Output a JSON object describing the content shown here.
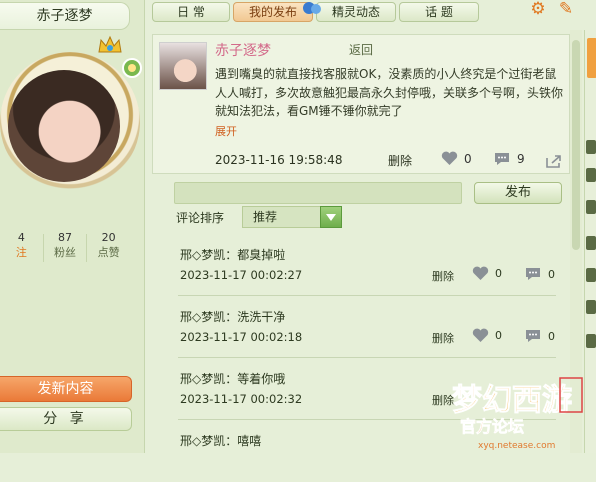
{
  "profile": {
    "username": "赤子逐梦",
    "stats": [
      {
        "num": "4",
        "label": "注"
      },
      {
        "num": "87",
        "label": "粉丝"
      },
      {
        "num": "20",
        "label": "点赞"
      }
    ],
    "post_button": "发新内容",
    "share_button": "分 享"
  },
  "tabs": [
    "日 常",
    "我的发布",
    "精灵动态",
    "话 题"
  ],
  "post": {
    "author": "赤子逐梦",
    "back": "返回",
    "text": "遇到嘴臭的就直接找客服就OK，没素质的小人终究是个过街老鼠人人喊打，多次故意触犯最高永久封停哦，关联多个号啊，头铁你就知法犯法，看GM锤不锤你就完了",
    "expand": "展开",
    "time": "2023-11-16 19:58:48",
    "delete": "删除",
    "likes": "0",
    "comments": "9"
  },
  "reply": {
    "publish": "发布",
    "sort_label": "评论排序",
    "sort_value": "推荐"
  },
  "comments": [
    {
      "text": "邢◇梦凯：都臭掉啦",
      "time": "2023-11-17 00:02:27",
      "delete": "删除",
      "likes": "0",
      "replies": "0"
    },
    {
      "text": "邢◇梦凯：洗洗干净",
      "time": "2023-11-17 00:02:18",
      "delete": "删除",
      "likes": "0",
      "replies": "0"
    },
    {
      "text": "邢◇梦凯：等着你哦",
      "time": "2023-11-17 00:02:32",
      "delete": "删除",
      "likes": "0",
      "replies": "0"
    },
    {
      "text": "邢◇梦凯：嘻嘻",
      "time": "",
      "delete": "",
      "likes": "",
      "replies": ""
    }
  ],
  "watermark": {
    "url": "xyq.netease.com",
    "text": "官方论坛"
  },
  "colors": {
    "accent": "#ea7a38",
    "bg": "#e6efd8",
    "pink_name": "#d36a8a"
  }
}
